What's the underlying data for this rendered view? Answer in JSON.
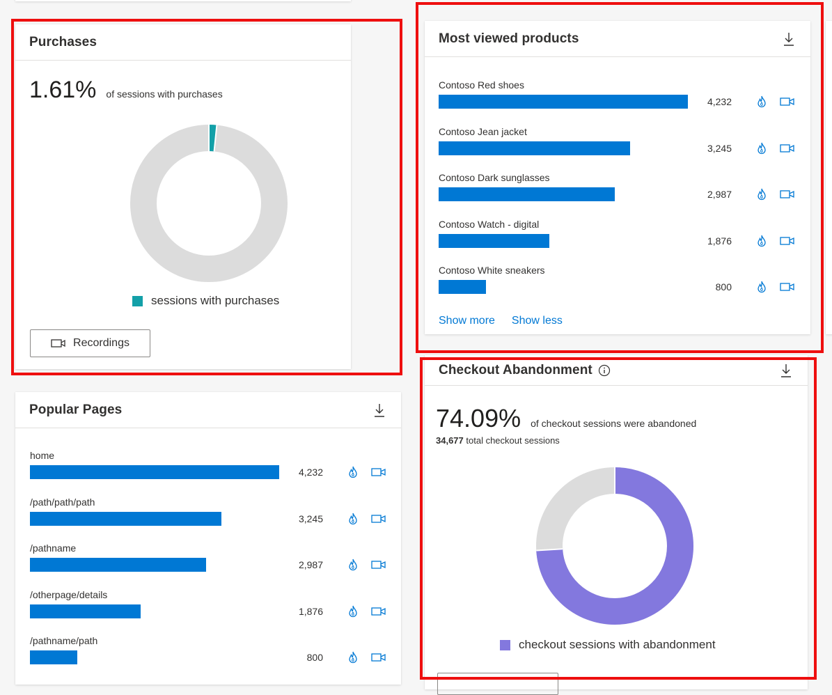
{
  "purchases": {
    "title": "Purchases",
    "percent": "1.61%",
    "caption": "of sessions with purchases",
    "legend": "sessions with purchases",
    "recordings_label": "Recordings"
  },
  "products": {
    "title": "Most viewed products",
    "items": [
      {
        "label": "Contoso Red shoes",
        "value": "4,232"
      },
      {
        "label": "Contoso Jean jacket",
        "value": "3,245"
      },
      {
        "label": "Contoso Dark sunglasses",
        "value": "2,987"
      },
      {
        "label": "Contoso Watch - digital",
        "value": "1,876"
      },
      {
        "label": "Contoso White sneakers",
        "value": "800"
      }
    ],
    "show_more": "Show more",
    "show_less": "Show less"
  },
  "pages": {
    "title": "Popular Pages",
    "items": [
      {
        "label": "home",
        "value": "4,232"
      },
      {
        "label": "/path/path/path",
        "value": "3,245"
      },
      {
        "label": "/pathname",
        "value": "2,987"
      },
      {
        "label": "/otherpage/details",
        "value": "1,876"
      },
      {
        "label": "/pathname/path",
        "value": "800"
      }
    ]
  },
  "checkout": {
    "title": "Checkout Abandonment",
    "percent": "74.09%",
    "caption": "of checkout sessions were abandoned",
    "total_count": "34,677",
    "total_label": "total checkout sessions",
    "legend": "checkout sessions with abandonment"
  },
  "colors": {
    "bar": "#0078d4",
    "purchase_teal": "#13a0a8",
    "abandon_purple": "#8378de",
    "donut_track": "#dcdcdc",
    "highlight_red": "#ee0f0f"
  },
  "icons": [
    "download-icon",
    "heatmap-flame-icon",
    "recording-camera-icon",
    "info-icon"
  ],
  "chart_data": [
    {
      "type": "pie",
      "title": "Purchases",
      "categories": [
        "sessions with purchases",
        "other"
      ],
      "values": [
        1.61,
        98.39
      ],
      "legend": "bottom"
    },
    {
      "type": "bar",
      "title": "Most viewed products",
      "categories": [
        "Contoso Red shoes",
        "Contoso Jean jacket",
        "Contoso Dark sunglasses",
        "Contoso Watch - digital",
        "Contoso White sneakers"
      ],
      "values": [
        4232,
        3245,
        2987,
        1876,
        800
      ]
    },
    {
      "type": "bar",
      "title": "Popular Pages",
      "categories": [
        "home",
        "/path/path/path",
        "/pathname",
        "/otherpage/details",
        "/pathname/path"
      ],
      "values": [
        4232,
        3245,
        2987,
        1876,
        800
      ]
    },
    {
      "type": "pie",
      "title": "Checkout Abandonment",
      "categories": [
        "checkout sessions with abandonment",
        "other"
      ],
      "values": [
        74.09,
        25.91
      ],
      "legend": "bottom"
    }
  ]
}
